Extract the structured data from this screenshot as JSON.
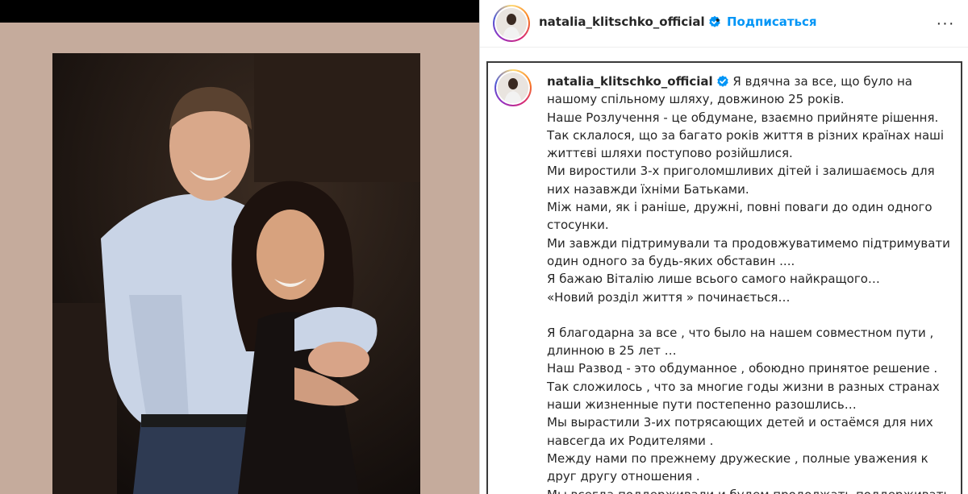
{
  "post": {
    "username": "natalia_klitschko_official",
    "follow_label": "Подписаться",
    "dot": "•",
    "more_label": "···",
    "verified_color": "#0095f6"
  },
  "caption": {
    "first_line": "Я вдячна за все, що було на",
    "lines": [
      "нашому спільному шляху, довжиною 25 років.",
      "Наше Розлучення - це обдумане, взаємно прийняте рішення.",
      "Так склалося, що за багато років життя в різних країнах наші",
      "життєві шляхи поступово розійшлися.",
      "Ми виростили 3-х приголомшливих дітей і залишаємось для",
      "них назавжди їхніми Батьками.",
      "Між нами, як і раніше, дружні, повні поваги до один одного",
      "стосунки.",
      "Ми завжди підтримували та продовжуватимемо підтримувати",
      "один одного за будь-яких обставин ....",
      "Я бажаю Віталію лише всього самого найкращого…",
      "«Новий розділ життя » починається…",
      "",
      "Я благодарна за все , что было на нашем совместном пути ,",
      "длинною в 25 лет …",
      "Наш Развод - это обдуманное , обоюдно принятое решение .",
      "Так сложилось , что за многие годы жизни в разных странах",
      "наши жизненные пути постепенно разошлись…",
      "Мы вырастили 3-их потрясающих детей и остаёмся для них",
      "навсегда их Родителями .",
      "Между нами по прежнему дружеские , полные уважения к",
      "друг другу отношения .",
      "Мы всегда поддерживали и будем продолжать поддерживать"
    ]
  },
  "colors": {
    "accent": "#0095f6",
    "mat": "#c5ab9c",
    "text": "#262626"
  }
}
